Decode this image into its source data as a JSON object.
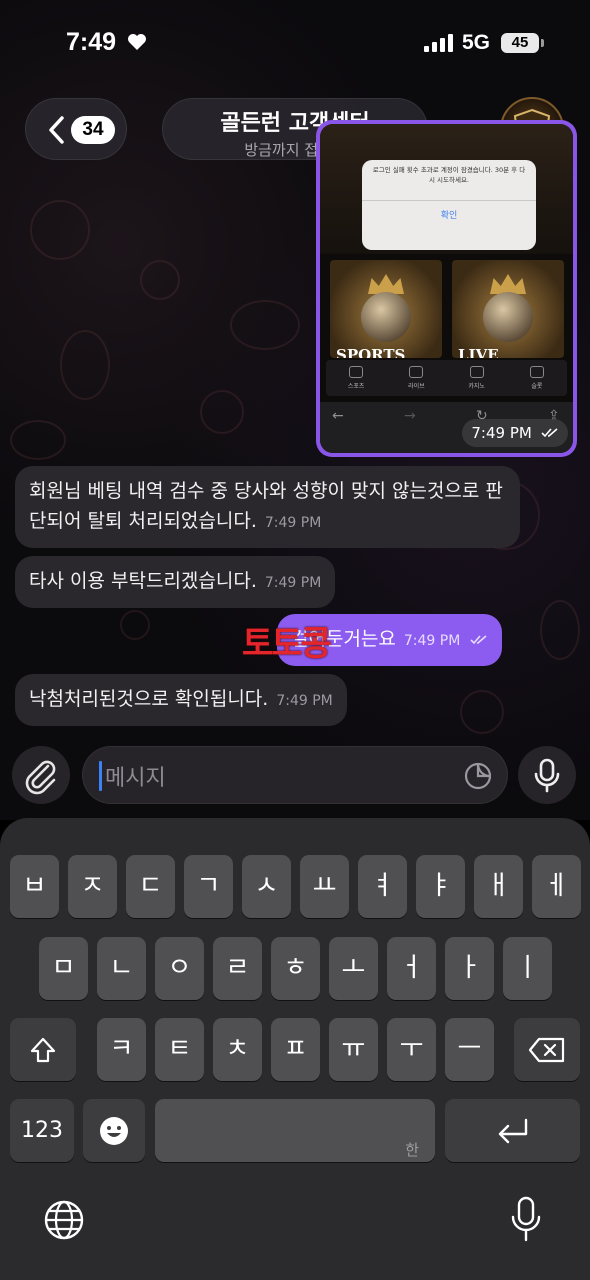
{
  "status_bar": {
    "time": "7:49",
    "network": "5G",
    "battery": "45"
  },
  "header": {
    "unread_count": "34",
    "title": "골든런 고객센터",
    "subtitle": "방금까지 접속함",
    "avatar_text": "GR"
  },
  "image_message": {
    "dialog_text": "로그인 실패 횟수 초과로 계정이 잠겼습니다. 30분 후 다시 시도하세요.",
    "dialog_button": "확인",
    "cards": [
      "SPORTS",
      "LIVE"
    ],
    "nav_items": [
      "스포츠",
      "라이브",
      "카지노",
      "슬롯"
    ],
    "time": "7:49 PM"
  },
  "messages": [
    {
      "direction": "in",
      "text": "회원님 베팅 내역 검수 중 당사와 성향이 맞지 않는것으로 판단되어 탈퇴 처리되었습니다.",
      "time": "7:49 PM"
    },
    {
      "direction": "in",
      "text": "타사 이용 부탁드리겠습니다.",
      "time": "7:49 PM"
    },
    {
      "direction": "out",
      "text": "걸어둔거는요",
      "time": "7:49 PM"
    },
    {
      "direction": "in",
      "text": "낙첨처리된것으로 확인됩니다.",
      "time": "7:49 PM"
    }
  ],
  "watermark": "토토콩",
  "composer": {
    "placeholder": "메시지"
  },
  "keyboard": {
    "row1": [
      "ㅂ",
      "ㅈ",
      "ㄷ",
      "ㄱ",
      "ㅅ",
      "ㅛ",
      "ㅕ",
      "ㅑ",
      "ㅐ",
      "ㅔ"
    ],
    "row2": [
      "ㅁ",
      "ㄴ",
      "ㅇ",
      "ㄹ",
      "ㅎ",
      "ㅗ",
      "ㅓ",
      "ㅏ",
      "ㅣ"
    ],
    "row3": [
      "ㅋ",
      "ㅌ",
      "ㅊ",
      "ㅍ",
      "ㅠ",
      "ㅜ",
      "ㅡ"
    ],
    "numbers_key": "123",
    "space_hint": "한"
  },
  "colors": {
    "outgoing_bubble": "#8c5cf1",
    "incoming_bubble": "#2a272d",
    "watermark": "#e4252b"
  }
}
